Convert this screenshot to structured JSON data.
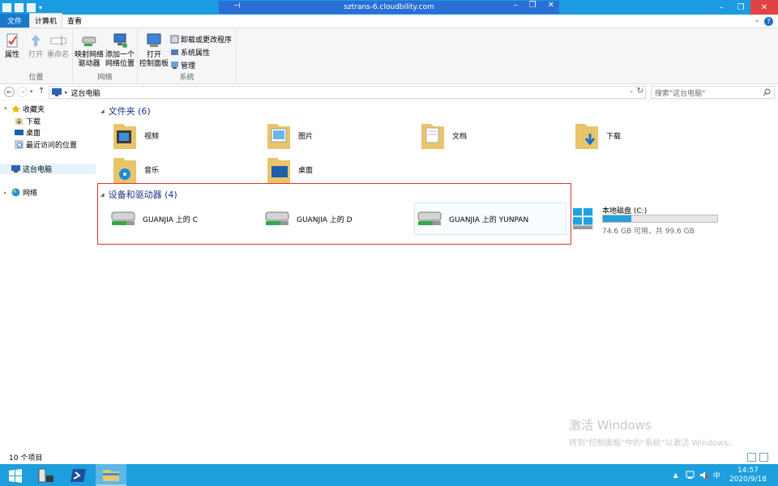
{
  "window": {
    "title": "sztrans-6.cloudbility.com"
  },
  "ribbon": {
    "tabs": [
      "文件",
      "计算机",
      "查看"
    ],
    "groups": {
      "location": {
        "label": "位置",
        "properties": "属性",
        "open": "打开",
        "rename": "重命名"
      },
      "network": {
        "label": "网络",
        "map_drive_l1": "映射网络",
        "map_drive_l2": "驱动器",
        "add_location_l1": "添加一个",
        "add_location_l2": "网络位置"
      },
      "system": {
        "label": "系统",
        "control_panel_l1": "打开",
        "control_panel_l2": "控制面板",
        "uninstall": "卸载或更改程序",
        "system_properties": "系统属性",
        "manage": "管理"
      }
    }
  },
  "address": {
    "path": "这台电脑",
    "search_placeholder": "搜索\"这台电脑\""
  },
  "nav": {
    "favorites": "收藏夹",
    "downloads": "下载",
    "desktop": "桌面",
    "recent": "最近访问的位置",
    "this_pc": "这台电脑",
    "network": "网络"
  },
  "folders_section": {
    "title": "文件夹 (6)",
    "items": [
      "视频",
      "图片",
      "文档",
      "下载",
      "音乐",
      "桌面"
    ]
  },
  "devices_section": {
    "title": "设备和驱动器 (4)",
    "drives": [
      "GUANJIA 上的 C",
      "GUANJIA 上的 D",
      "GUANJIA 上的 YUNPAN"
    ],
    "local_disk": {
      "name": "本地磁盘 (C:)",
      "free_text": "74.6 GB 可用，共 99.6 GB",
      "used_fraction": 0.251
    }
  },
  "watermark": {
    "line1": "激活 Windows",
    "line2": "转到\"控制面板\"中的\"系统\"以激活 Windows。"
  },
  "status": {
    "count": "10 个项目"
  },
  "taskbar": {
    "time": "14:57",
    "date": "2020/9/18",
    "ime": "中"
  },
  "colors": {
    "accent": "#1979ca",
    "taskbar": "#1d9fdd",
    "highlight_border": "#e3302f",
    "disk_fill": "#26a0da"
  }
}
